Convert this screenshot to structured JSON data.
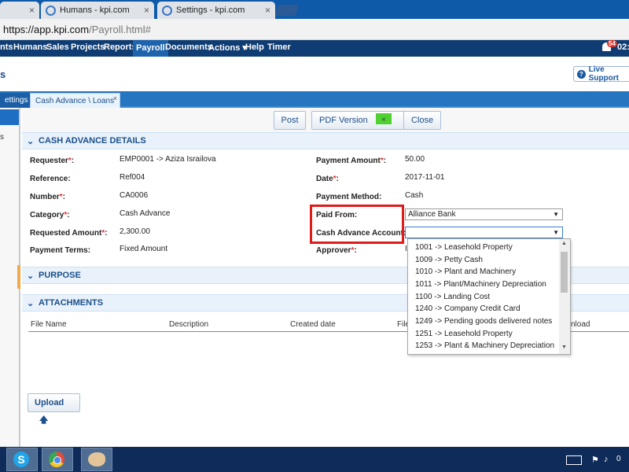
{
  "browser": {
    "tabs": [
      {
        "label": "",
        "close": "×"
      },
      {
        "label": "Humans - kpi.com",
        "close": "×"
      },
      {
        "label": "Settings - kpi.com",
        "close": "×"
      }
    ],
    "url_host": "https://app.kpi.com",
    "url_path": "/Payroll.html#"
  },
  "appnav": {
    "items": [
      "nts",
      "Humans",
      "Sales",
      "Projects",
      "Reports",
      "Payroll",
      "Documents",
      "Actions ▾",
      "Help",
      "Timer"
    ],
    "active": "Payroll",
    "notif_count": "54",
    "clock": "02:"
  },
  "page": {
    "title": "s",
    "live_support": "Live Support"
  },
  "pagetabs": {
    "inactive": "ettings",
    "active": "Cash Advance \\ Loans",
    "close": "×"
  },
  "leftstrip": {
    "text": "s"
  },
  "toolbar": {
    "post": "Post",
    "pdf": "PDF Version",
    "arrow": "«",
    "close": "Close"
  },
  "sections": {
    "details": "CASH ADVANCE DETAILS",
    "purpose": "PURPOSE",
    "attachments": "ATTACHMENTS"
  },
  "form": {
    "left": [
      {
        "label": "Requester",
        "required": true,
        "value": "EMP0001 -> Aziza Israilova"
      },
      {
        "label": "Reference:",
        "required": false,
        "value": "Ref004"
      },
      {
        "label": "Number",
        "required": true,
        "value": "CA0006"
      },
      {
        "label": "Category",
        "required": true,
        "value": "Cash Advance"
      },
      {
        "label": "Requested Amount",
        "required": true,
        "value": "2,300.00"
      },
      {
        "label": "Payment Terms:",
        "required": false,
        "value": "Fixed Amount"
      }
    ],
    "right": [
      {
        "label": "Payment Amount",
        "required": true,
        "value": "50.00"
      },
      {
        "label": "Date",
        "required": true,
        "value": "2017-11-01"
      },
      {
        "label": "Payment Method:",
        "required": false,
        "value": "Cash"
      },
      {
        "label": "Paid From:",
        "required": false,
        "value": "Alliance Bank"
      },
      {
        "label": "Cash Advance Account:",
        "required": false,
        "value": ""
      },
      {
        "label": "Approver",
        "required": true,
        "value": "I"
      }
    ],
    "required_marker": "*",
    "colon": ":"
  },
  "dropdown": {
    "options": [
      "1001 -> Leasehold Property",
      "1009 -> Petty Cash",
      "1010 -> Plant and Machinery",
      "1011 -> Plant/Machinery Depreciation",
      "1100 -> Landing Cost",
      "1240 -> Company Credit Card",
      "1249 -> Pending goods delivered notes",
      "1251 -> Leasehold Property",
      "1253 -> Plant & Machinery Depreciation"
    ]
  },
  "attachments": {
    "columns": [
      "File Name",
      "Description",
      "Created date",
      "File",
      "nload"
    ],
    "upload": "Upload"
  },
  "taskbar": {
    "clock": "0"
  }
}
